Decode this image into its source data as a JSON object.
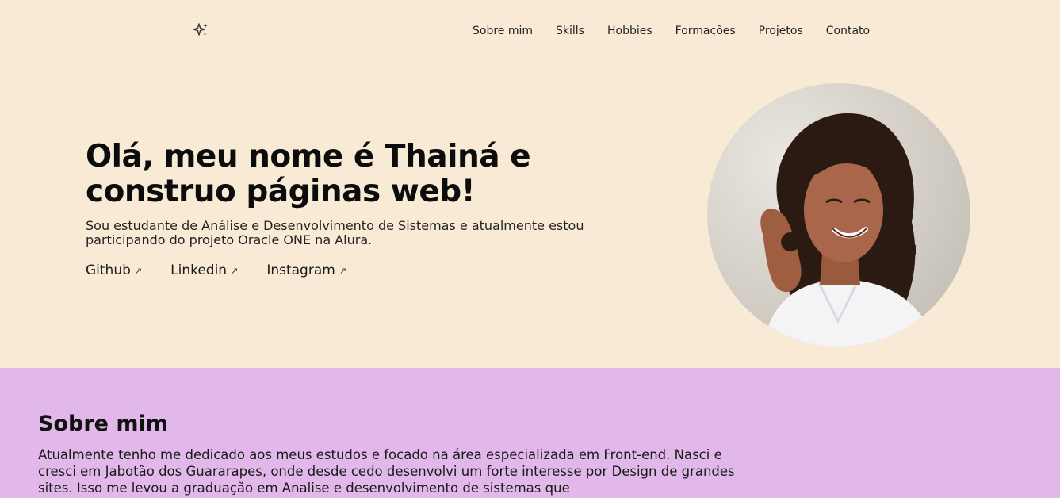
{
  "nav": {
    "logo_icon": "sparkles-icon",
    "items": [
      "Sobre mim",
      "Skills",
      "Hobbies",
      "Formações",
      "Projetos",
      "Contato"
    ]
  },
  "hero": {
    "title": "Olá, meu nome é Thainá e construo páginas web!",
    "subtitle": "Sou estudante de Análise e Desenvolvimento de Sistemas e atualmente estou participando do projeto Oracle ONE na Alura.",
    "links": [
      {
        "label": "Github",
        "icon": "external-arrow-icon"
      },
      {
        "label": "Linkedin",
        "icon": "external-arrow-icon"
      },
      {
        "label": "Instagram",
        "icon": "external-arrow-icon"
      }
    ],
    "photo_icon": "profile-photo"
  },
  "about": {
    "heading": "Sobre mim",
    "text": "Atualmente tenho me dedicado aos meus estudos e focado na área especializada em Front-end. Nasci e cresci em Jabotão dos Guararapes, onde desde cedo desenvolvi um forte interesse por Design de grandes sites. Isso me levou a graduação em Analise e desenvolvimento de sistemas que"
  },
  "colors": {
    "hero_bg": "#f9ead6",
    "about_bg": "#e2b8ea",
    "text": "#111111"
  }
}
